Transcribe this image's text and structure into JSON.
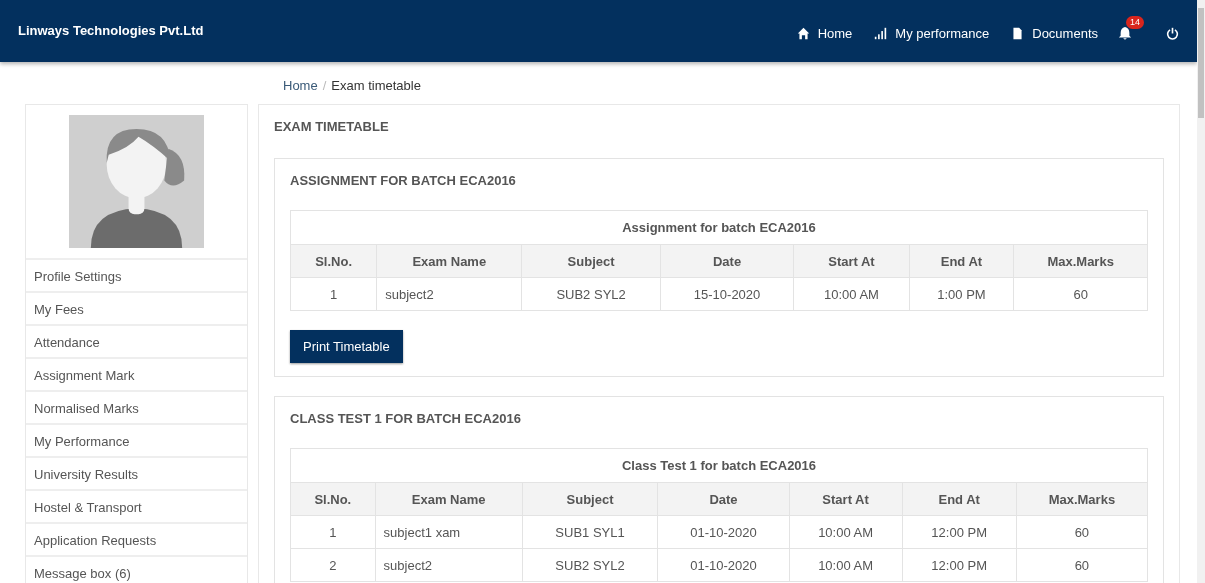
{
  "navbar": {
    "brand": "Linways Technologies Pvt.Ltd",
    "links": [
      {
        "kind": "home",
        "label": "Home"
      },
      {
        "kind": "performance",
        "label": "My performance"
      },
      {
        "kind": "documents",
        "label": "Documents"
      }
    ],
    "notifications": {
      "count": "14"
    }
  },
  "breadcrumb": {
    "items": [
      "Home",
      "Exam timetable"
    ],
    "separator": "/"
  },
  "sidebar": {
    "items": [
      {
        "label": "Profile Settings"
      },
      {
        "label": "My Fees"
      },
      {
        "label": "Attendance"
      },
      {
        "label": "Assignment Mark"
      },
      {
        "label": "Normalised Marks"
      },
      {
        "label": "My Performance"
      },
      {
        "label": "University Results"
      },
      {
        "label": "Hostel & Transport"
      },
      {
        "label": "Application Requests"
      },
      {
        "label": "Message box (6)"
      }
    ]
  },
  "page_title": "EXAM TIMETABLE",
  "sections": [
    {
      "title": "ASSIGNMENT FOR BATCH ECA2016",
      "caption": "Assignment for batch ECA2016",
      "columns": [
        "Sl.No.",
        "Exam Name",
        "Subject",
        "Date",
        "Start At",
        "End At",
        "Max.Marks"
      ],
      "rows": [
        [
          "1",
          "subject2",
          "SUB2 SYL2",
          "15-10-2020",
          "10:00 AM",
          "1:00 PM",
          "60"
        ]
      ],
      "button": "Print Timetable"
    },
    {
      "title": "CLASS TEST 1 FOR BATCH ECA2016",
      "caption": "Class Test 1 for batch ECA2016",
      "columns": [
        "Sl.No.",
        "Exam Name",
        "Subject",
        "Date",
        "Start At",
        "End At",
        "Max.Marks"
      ],
      "rows": [
        [
          "1",
          "subject1 xam",
          "SUB1 SYL1",
          "01-10-2020",
          "10:00 AM",
          "12:00 PM",
          "60"
        ],
        [
          "2",
          "subject2",
          "SUB2 SYL2",
          "01-10-2020",
          "10:00 AM",
          "12:00 PM",
          "60"
        ]
      ]
    }
  ]
}
